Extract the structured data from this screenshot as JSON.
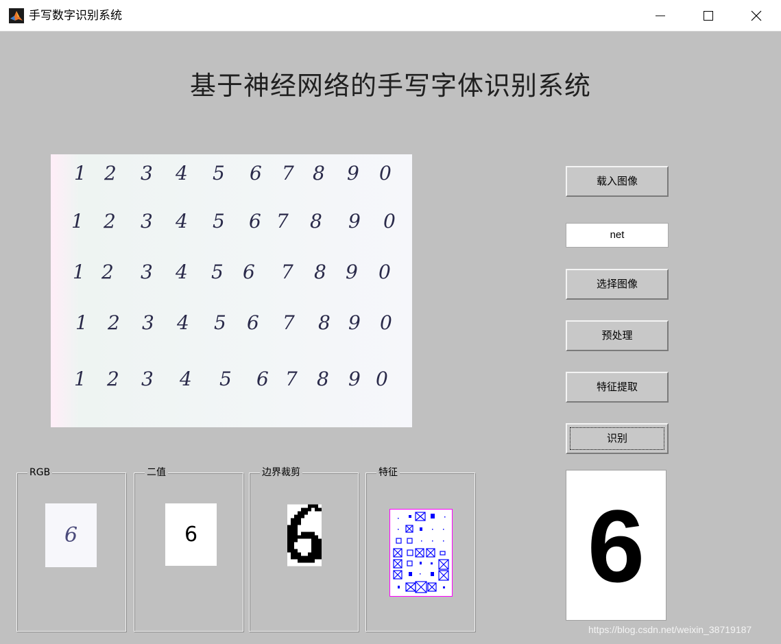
{
  "window": {
    "title": "手写数字识别系统"
  },
  "heading": "基于神经网络的手写字体识别系统",
  "sample_rows": [
    [
      "1",
      "2",
      "3",
      "4",
      "5",
      "6",
      "7",
      "8",
      "9",
      "0"
    ],
    [
      "1",
      "2",
      "3",
      "4",
      "5",
      "6",
      "7",
      "8",
      "9",
      "0"
    ],
    [
      "1",
      "2",
      "3",
      "4",
      "5",
      "6",
      "7",
      "8",
      "9",
      "0"
    ],
    [
      "1",
      "2",
      "3",
      "4",
      "5",
      "6",
      "7",
      "8",
      "9",
      "0"
    ],
    [
      "1",
      "2",
      "3",
      "4",
      "5",
      "6",
      "7",
      "8",
      "9",
      "0"
    ]
  ],
  "buttons": {
    "load": "载入图像",
    "select": "选择图像",
    "preprocess": "预处理",
    "feature": "特征提取",
    "recognize": "识别"
  },
  "net_field": {
    "value": "net"
  },
  "panels": {
    "rgb": {
      "label": "RGB",
      "digit": "6"
    },
    "binary": {
      "label": "二值",
      "digit": "6"
    },
    "crop": {
      "label": "边界裁剪"
    },
    "feature": {
      "label": "特征"
    }
  },
  "result": "6",
  "watermark": "https://blog.csdn.net/weixin_38719187",
  "colors": {
    "background": "#c0c0c0",
    "feature_border": "#ff00ff",
    "feature_marker": "#0000ff"
  }
}
